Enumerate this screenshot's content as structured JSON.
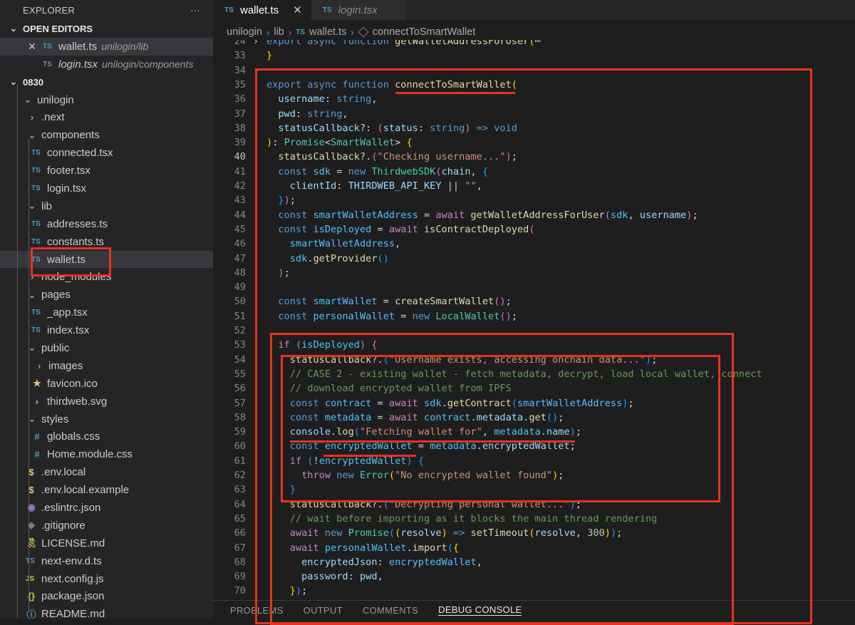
{
  "explorer": {
    "title": "EXPLORER",
    "more": "···",
    "open_editors_label": "OPEN EDITORS",
    "open_editors": [
      {
        "name": "wallet.ts",
        "path": "unilogin/lib"
      },
      {
        "name": "login.tsx",
        "path": "unilogin/components"
      }
    ],
    "workspace_label": "0830",
    "tree": [
      {
        "label": "unilogin",
        "kind": "folder-open"
      },
      {
        "label": ".next",
        "kind": "folder"
      },
      {
        "label": "components",
        "kind": "folder-open"
      },
      {
        "label": "connected.tsx",
        "kind": "ts"
      },
      {
        "label": "footer.tsx",
        "kind": "ts"
      },
      {
        "label": "login.tsx",
        "kind": "ts"
      },
      {
        "label": "lib",
        "kind": "folder-open"
      },
      {
        "label": "addresses.ts",
        "kind": "ts"
      },
      {
        "label": "constants.ts",
        "kind": "ts"
      },
      {
        "label": "wallet.ts",
        "kind": "ts"
      },
      {
        "label": "node_modules",
        "kind": "folder"
      },
      {
        "label": "pages",
        "kind": "folder-open"
      },
      {
        "label": "_app.tsx",
        "kind": "ts"
      },
      {
        "label": "index.tsx",
        "kind": "ts"
      },
      {
        "label": "public",
        "kind": "folder-open"
      },
      {
        "label": "images",
        "kind": "folder"
      },
      {
        "label": "favicon.ico",
        "kind": "star"
      },
      {
        "label": "thirdweb.svg",
        "kind": "svg"
      },
      {
        "label": "styles",
        "kind": "folder-open"
      },
      {
        "label": "globals.css",
        "kind": "css"
      },
      {
        "label": "Home.module.css",
        "kind": "css"
      },
      {
        "label": ".env.local",
        "kind": "env"
      },
      {
        "label": ".env.local.example",
        "kind": "env"
      },
      {
        "label": ".eslintrc.json",
        "kind": "eslint"
      },
      {
        "label": ".gitignore",
        "kind": "git"
      },
      {
        "label": "LICENSE.md",
        "kind": "license"
      },
      {
        "label": "next-env.d.ts",
        "kind": "ts"
      },
      {
        "label": "next.config.js",
        "kind": "js"
      },
      {
        "label": "package.json",
        "kind": "json"
      },
      {
        "label": "README.md",
        "kind": "info"
      }
    ]
  },
  "tabs": [
    {
      "label": "wallet.ts",
      "icon": "TS",
      "close": "✕"
    },
    {
      "label": "login.tsx",
      "icon": "TS"
    }
  ],
  "breadcrumb": {
    "parts": [
      "unilogin",
      "lib",
      "wallet.ts",
      "connectToSmartWallet"
    ],
    "ts_icon": "TS"
  },
  "editor": {
    "lines": [
      {
        "n": "24",
        "html": "<span class=\"k\">export</span> <span class=\"k\">async</span> <span class=\"k\">function</span> <span class=\"f\">getWalletAddressForUser</span><span class=\"b1\">(</span><span class=\"p\">⋯</span>"
      },
      {
        "n": "33",
        "html": "<span class=\"b1\">}</span>"
      },
      {
        "n": "34",
        "html": ""
      },
      {
        "n": "35",
        "html": "<span class=\"k\">export</span> <span class=\"k\">async</span> <span class=\"k\">function</span> <span class=\"f\">connectToSmartWallet</span><span class=\"b1\">(</span>"
      },
      {
        "n": "36",
        "html": "  <span class=\"v\">username</span>: <span class=\"k\">string</span>,"
      },
      {
        "n": "37",
        "html": "  <span class=\"v\">pwd</span>: <span class=\"k\">string</span>,"
      },
      {
        "n": "38",
        "html": "  <span class=\"v\">statusCallback</span>?: <span class=\"b2\">(</span><span class=\"v\">status</span>: <span class=\"k\">string</span><span class=\"b2\">)</span> <span class=\"k\">=&gt;</span> <span class=\"k\">void</span>"
      },
      {
        "n": "39",
        "html": "<span class=\"b1\">)</span>: <span class=\"t\">Promise</span>&lt;<span class=\"t\">SmartWallet</span>&gt; <span class=\"b1\">{</span>"
      },
      {
        "n": "40",
        "html": "  <span class=\"f\">statusCallback</span>?.<span class=\"b2\">(</span><span class=\"s\">\"Checking username...\"</span><span class=\"b2\">)</span>;"
      },
      {
        "n": "41",
        "html": "  <span class=\"k\">const</span> <span class=\"cn\">sdk</span> = <span class=\"k\">new</span> <span class=\"t\">ThirdwebSDK</span><span class=\"b2\">(</span><span class=\"v\">chain</span>, <span class=\"b3\">{</span>"
      },
      {
        "n": "42",
        "html": "    <span class=\"v\">clientId</span>: <span class=\"v\">THIRDWEB_API_KEY</span> || <span class=\"s\">\"\"</span>,"
      },
      {
        "n": "43",
        "html": "  <span class=\"b3\">}</span><span class=\"b2\">)</span>;"
      },
      {
        "n": "44",
        "html": "  <span class=\"k\">const</span> <span class=\"cn\">smartWalletAddress</span> = <span class=\"kc\">await</span> <span class=\"f\">getWalletAddressForUser</span><span class=\"b2\">(</span><span class=\"cn\">sdk</span>, <span class=\"v\">username</span><span class=\"b2\">)</span>;"
      },
      {
        "n": "45",
        "html": "  <span class=\"k\">const</span> <span class=\"cn\">isDeployed</span> = <span class=\"kc\">await</span> <span class=\"f\">isContractDeployed</span><span class=\"b2\">(</span>"
      },
      {
        "n": "46",
        "html": "    <span class=\"cn\">smartWalletAddress</span>,"
      },
      {
        "n": "47",
        "html": "    <span class=\"cn\">sdk</span>.<span class=\"f\">getProvider</span><span class=\"b3\">()</span>"
      },
      {
        "n": "48",
        "html": "  <span class=\"b2\">)</span>;"
      },
      {
        "n": "49",
        "html": ""
      },
      {
        "n": "50",
        "html": "  <span class=\"k\">const</span> <span class=\"cn\">smartWallet</span> = <span class=\"f\">createSmartWallet</span><span class=\"b2\">()</span>;"
      },
      {
        "n": "51",
        "html": "  <span class=\"k\">const</span> <span class=\"cn\">personalWallet</span> = <span class=\"k\">new</span> <span class=\"t\">LocalWallet</span><span class=\"b2\">()</span>;"
      },
      {
        "n": "52",
        "html": ""
      },
      {
        "n": "53",
        "html": "  <span class=\"kc\">if</span> <span class=\"b2\">(</span><span class=\"cn\">isDeployed</span><span class=\"b2\">)</span> <span class=\"b2\">{</span>"
      },
      {
        "n": "54",
        "html": "    <span class=\"f\">statusCallback</span>?.<span class=\"b3\">(</span><span class=\"s\">\"Username exists, accessing onchain data...\"</span><span class=\"b3\">)</span>;"
      },
      {
        "n": "55",
        "html": "    <span class=\"c\">// CASE 2 - existing wallet - fetch metadata, decrypt, load local wallet, connect</span>"
      },
      {
        "n": "56",
        "html": "    <span class=\"c\">// download encrypted wallet from IPFS</span>"
      },
      {
        "n": "57",
        "html": "    <span class=\"k\">const</span> <span class=\"cn\">contract</span> = <span class=\"kc\">await</span> <span class=\"cn\">sdk</span>.<span class=\"f\">getContract</span><span class=\"b3\">(</span><span class=\"cn\">smartWalletAddress</span><span class=\"b3\">)</span>;"
      },
      {
        "n": "58",
        "html": "    <span class=\"k\">const</span> <span class=\"cn\">metadata</span> = <span class=\"kc\">await</span> <span class=\"cn\">contract</span>.<span class=\"v\">metadata</span>.<span class=\"f\">get</span><span class=\"b3\">()</span>;"
      },
      {
        "n": "59",
        "html": "    <span class=\"v\">console</span>.<span class=\"f\">log</span><span class=\"b3\">(</span><span class=\"s\">\"Fetching wallet for\"</span>, <span class=\"cn\">metadata</span>.<span class=\"v\">name</span><span class=\"b3\">)</span>;"
      },
      {
        "n": "60",
        "html": "    <span class=\"k\">const</span> <span class=\"cn\">encryptedWallet</span> = <span class=\"cn\">metadata</span>.<span class=\"v\">encryptedWallet</span>;"
      },
      {
        "n": "61",
        "html": "    <span class=\"kc\">if</span> <span class=\"b3\">(</span>!<span class=\"cn\">encryptedWallet</span><span class=\"b3\">)</span> <span class=\"b3\">{</span>"
      },
      {
        "n": "62",
        "html": "      <span class=\"kc\">throw</span> <span class=\"k\">new</span> <span class=\"t\">Error</span><span class=\"b1\">(</span><span class=\"s\">\"No encrypted wallet found\"</span><span class=\"b1\">)</span>;"
      },
      {
        "n": "63",
        "html": "    <span class=\"b3\">}</span>"
      },
      {
        "n": "64",
        "html": "    <span class=\"f\">statusCallback</span>?.<span class=\"b3\">(</span><span class=\"s\">\"Decrypting personal wallet...\"</span><span class=\"b3\">)</span>;"
      },
      {
        "n": "65",
        "html": "    <span class=\"c\">// wait before importing as it blocks the main thread rendering</span>"
      },
      {
        "n": "66",
        "html": "    <span class=\"kc\">await</span> <span class=\"k\">new</span> <span class=\"t\">Promise</span><span class=\"b3\">(</span><span class=\"b1\">(</span><span class=\"v\">resolve</span><span class=\"b1\">)</span> <span class=\"k\">=&gt;</span> <span class=\"f\">setTimeout</span><span class=\"b1\">(</span><span class=\"v\">resolve</span>, <span class=\"n\">300</span><span class=\"b1\">)</span><span class=\"b3\">)</span>;"
      },
      {
        "n": "67",
        "html": "    <span class=\"kc\">await</span> <span class=\"cn\">personalWallet</span>.<span class=\"f\">import</span><span class=\"b3\">(</span><span class=\"b1\">{</span>"
      },
      {
        "n": "68",
        "html": "      <span class=\"v\">encryptedJson</span>: <span class=\"cn\">encryptedWallet</span>,"
      },
      {
        "n": "69",
        "html": "      <span class=\"v\">password</span>: <span class=\"v\">pwd</span>,"
      },
      {
        "n": "70",
        "html": "    <span class=\"b1\">}</span><span class=\"b3\">)</span>;"
      }
    ]
  },
  "panel": {
    "tabs": [
      "PROBLEMS",
      "OUTPUT",
      "COMMENTS",
      "DEBUG CONSOLE"
    ]
  }
}
